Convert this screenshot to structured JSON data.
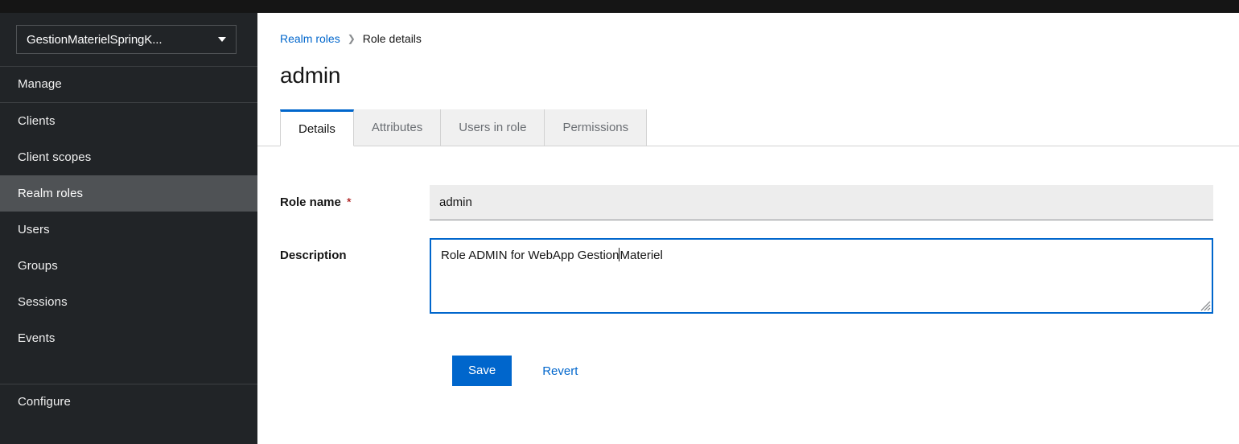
{
  "app": {
    "accent_color": "#0066cc",
    "sidebar_bg": "#212427",
    "masthead_bg": "#151515",
    "required_color": "#a30000"
  },
  "sidebar": {
    "realm_selector": {
      "label": "GestionMaterielSpringK...",
      "caret_icon": "chevron-down-icon"
    },
    "sections": [
      {
        "title": "Manage",
        "items": [
          {
            "label": "Clients",
            "active": false
          },
          {
            "label": "Client scopes",
            "active": false
          },
          {
            "label": "Realm roles",
            "active": true
          },
          {
            "label": "Users",
            "active": false
          },
          {
            "label": "Groups",
            "active": false
          },
          {
            "label": "Sessions",
            "active": false
          },
          {
            "label": "Events",
            "active": false
          }
        ]
      },
      {
        "title": "Configure",
        "items": []
      }
    ]
  },
  "content": {
    "breadcrumb": {
      "parent": "Realm roles",
      "separator_icon": "chevron-right-icon",
      "current": "Role details"
    },
    "page_title": "admin",
    "tabs": [
      {
        "label": "Details",
        "active": true
      },
      {
        "label": "Attributes",
        "active": false
      },
      {
        "label": "Users in role",
        "active": false
      },
      {
        "label": "Permissions",
        "active": false
      }
    ],
    "form": {
      "role_name": {
        "label": "Role name",
        "required_marker": "*",
        "value": "admin",
        "disabled": true
      },
      "description": {
        "label": "Description",
        "value": "Role ADMIN for WebApp GestionMateriel",
        "value_before_caret": "Role ADMIN for WebApp Gestion",
        "value_after_caret": "Materiel",
        "focused": true,
        "resize_handle_icon": "resize-grip-icon"
      },
      "actions": {
        "save_label": "Save",
        "revert_label": "Revert"
      }
    }
  }
}
